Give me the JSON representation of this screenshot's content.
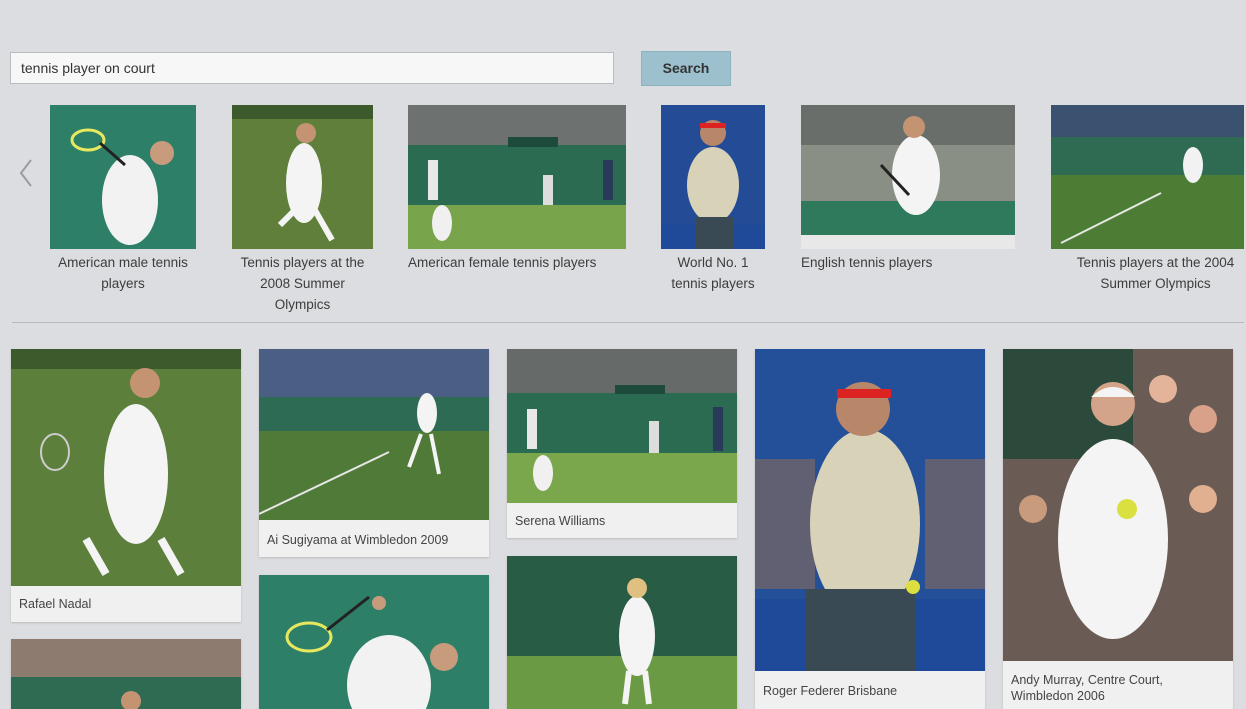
{
  "search": {
    "query": "tennis player on court",
    "button_label": "Search"
  },
  "categories": [
    {
      "caption_lines": [
        "American male tennis",
        "players"
      ]
    },
    {
      "caption_lines": [
        "Tennis players at the",
        "2008 Summer",
        "Olympics"
      ]
    },
    {
      "caption_lines": [
        "American female tennis players"
      ]
    },
    {
      "caption_lines": [
        "World No. 1",
        "tennis players"
      ]
    },
    {
      "caption_lines": [
        "English tennis players"
      ]
    },
    {
      "caption_lines": [
        "Tennis players at the 2004",
        "Summer Olympics"
      ]
    }
  ],
  "results": [
    {
      "label_lines": [
        "Rafael Nadal"
      ]
    },
    {
      "label_lines": [
        "Ai Sugiyama at Wimbledon 2009"
      ]
    },
    {
      "label_lines": [
        "Serena Williams"
      ]
    },
    {
      "label_lines": [
        "Roger Federer Brisbane"
      ]
    },
    {
      "label_lines": [
        "Andy Murray, Centre Court,",
        "Wimbledon 2006"
      ]
    },
    {
      "label_lines": []
    },
    {
      "label_lines": []
    },
    {
      "label_lines": []
    }
  ],
  "colors": {
    "page_bg": "#dcdde0",
    "button_bg": "#9cc0ce",
    "grass_green": "#4f7a3a",
    "court_teal": "#2b7a63"
  },
  "icons": {
    "prev": "chevron-left-icon"
  }
}
